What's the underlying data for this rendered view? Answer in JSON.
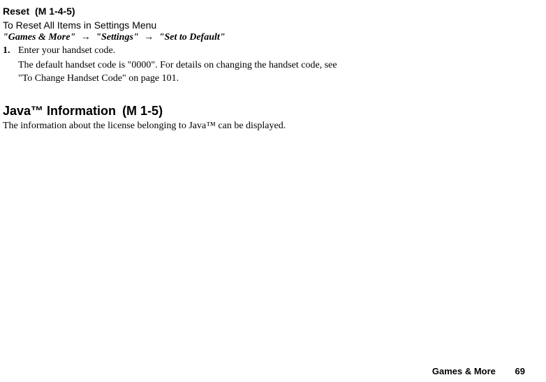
{
  "section1": {
    "title": "Reset",
    "code": "(M 1-4-5)",
    "subtitle": "To Reset All Items in Settings Menu",
    "nav": {
      "part1": "\"Games & More\"",
      "part2": "\"Settings\"",
      "part3": "\"Set to Default\""
    },
    "item": {
      "number": "1.",
      "step": "Enter your handset code.",
      "detail": "The default handset code is \"0000\". For details on changing the handset code, see \"To Change Handset Code\" on page 101."
    }
  },
  "section2": {
    "title": "Java™ Information",
    "code": "(M 1-5)",
    "body": "The information about the license belonging to Java™ can be displayed."
  },
  "footer": {
    "label": "Games & More",
    "page": "69"
  }
}
